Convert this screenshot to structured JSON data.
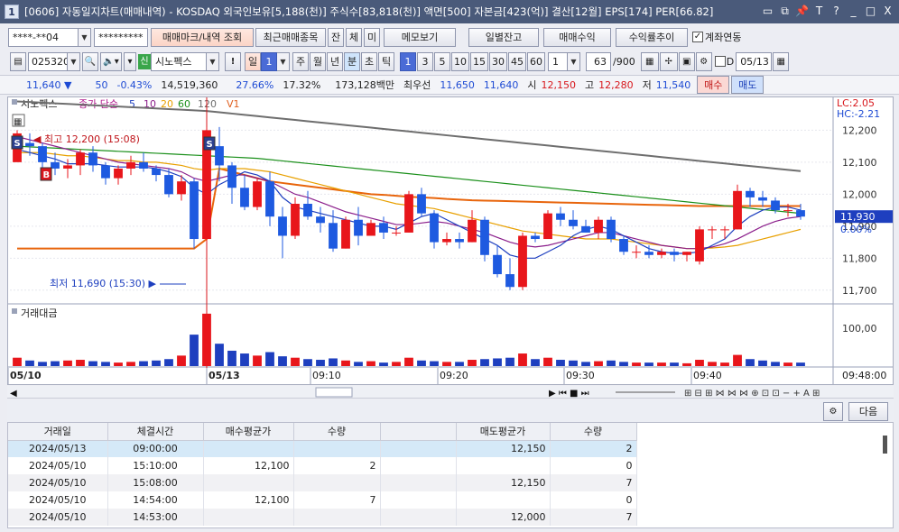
{
  "window": {
    "icon": "1",
    "title": "[0606] 자동일지차트(매매내역) - KOSDAQ 외국인보유[5,188(천)] 주식수[83,818(천)] 액면[500] 자본금[423(억)] 결산[12월] EPS[174] PER[66.82]",
    "controls": [
      "▭",
      "⧉",
      "📌",
      "T",
      "?",
      "_",
      "□",
      "X"
    ]
  },
  "toolbar1": {
    "account": "****-**04",
    "password": "*********",
    "trade_mark_btn": "매매마크/내역 조회",
    "recent_btn": "최근매매종목",
    "jan_btn": "잔",
    "che_btn": "체",
    "mi_btn": "미",
    "memo_btn": "메모보기",
    "daily_balance_btn": "일별잔고",
    "trade_profit_btn": "매매수익",
    "profit_rate_btn": "수익률추이",
    "account_link_label": "계좌연동",
    "account_link_checked": true
  },
  "toolbar2": {
    "code": "025320",
    "new_badge": "신",
    "stock_name": "시노펙스",
    "excl": "!",
    "periods": [
      "일",
      "1",
      "주",
      "월",
      "년",
      "분",
      "초",
      "틱"
    ],
    "period_selected": "분",
    "intervals": [
      "1",
      "3",
      "5",
      "10",
      "15",
      "30",
      "45",
      "60"
    ],
    "interval_selected": "1",
    "interval_value": "1",
    "count": "63",
    "count_total": "/900",
    "date_check_label": "D",
    "date": "05/13"
  },
  "quote": {
    "price": "11,640",
    "change": "50",
    "change_pct": "-0.43%",
    "volume": "14,519,360",
    "pct1": "27.66%",
    "pct2": "17.32%",
    "amount": "173,128백만",
    "pref_label": "최우선",
    "ask": "11,650",
    "bid": "11,640",
    "open_label": "시",
    "open": "12,150",
    "high_label": "고",
    "high": "12,280",
    "low_label": "저",
    "low": "11,540",
    "buy_btn": "매수",
    "sell_btn": "매도"
  },
  "chart_data": {
    "type": "candlestick",
    "legend": {
      "stock": "시노펙스",
      "ma_label": "종가 단순",
      "ma_periods": [
        "5",
        "10",
        "20",
        "60",
        "120"
      ],
      "ma_colors": [
        "#1e3fbf",
        "#8b1e8b",
        "#e8a000",
        "#1a8f1a",
        "#6e6e6e"
      ],
      "volume_label": "V1"
    },
    "right_labels": {
      "lc": "LC:2.05",
      "hc": "HC:-2.21"
    },
    "y_ticks": [
      "12,200",
      "12,100",
      "12,000",
      "11,900",
      "11,800",
      "11,700"
    ],
    "y_range": [
      11660,
      12280
    ],
    "current_price_label": "11,930",
    "zero_label": "0.00%",
    "annotations": {
      "high": "최고 12,200 (15:08)",
      "low": "최저 11,690 (15:30)"
    },
    "trade_markers": [
      {
        "type": "S",
        "time": "15:08",
        "price": 12200
      },
      {
        "type": "B",
        "time": "15:10",
        "price": 12100
      },
      {
        "type": "S",
        "time": "09:00",
        "price": 12150
      }
    ],
    "x_labels": [
      "05/10",
      "05/13",
      "09:10",
      "09:20",
      "09:30",
      "09:40",
      "09:48:00"
    ],
    "candles": [
      [
        12100,
        12200,
        12150,
        12190
      ],
      [
        12160,
        12190,
        12120,
        12150
      ],
      [
        12150,
        12160,
        12080,
        12100
      ],
      [
        12100,
        12130,
        12060,
        12080
      ],
      [
        12080,
        12110,
        12050,
        12090
      ],
      [
        12090,
        12140,
        12060,
        12130
      ],
      [
        12130,
        12150,
        12070,
        12090
      ],
      [
        12090,
        12100,
        12030,
        12050
      ],
      [
        12050,
        12090,
        12030,
        12080
      ],
      [
        12080,
        12120,
        12060,
        12100
      ],
      [
        12100,
        12130,
        12070,
        12080
      ],
      [
        12080,
        12090,
        12040,
        12060
      ],
      [
        12060,
        12080,
        11990,
        12000
      ],
      [
        12000,
        12060,
        11980,
        12040
      ],
      [
        12040,
        12050,
        11830,
        11860
      ],
      [
        11860,
        12210,
        11850,
        12200
      ],
      [
        12150,
        12210,
        12040,
        12090
      ],
      [
        12090,
        12100,
        11970,
        12020
      ],
      [
        12020,
        12060,
        11950,
        11960
      ],
      [
        11960,
        12050,
        11950,
        12040
      ],
      [
        12040,
        12070,
        11900,
        11930
      ],
      [
        11930,
        11960,
        11800,
        11870
      ],
      [
        11870,
        11990,
        11860,
        11970
      ],
      [
        11970,
        12010,
        11920,
        11930
      ],
      [
        11930,
        11960,
        11880,
        11910
      ],
      [
        11910,
        11950,
        11820,
        11830
      ],
      [
        11830,
        11930,
        11830,
        11920
      ],
      [
        11920,
        11960,
        11840,
        11870
      ],
      [
        11870,
        11920,
        11870,
        11910
      ],
      [
        11910,
        11930,
        11860,
        11880
      ],
      [
        11880,
        11900,
        11870,
        11880
      ],
      [
        11880,
        12010,
        11880,
        12000
      ],
      [
        12000,
        12020,
        11930,
        11940
      ],
      [
        11940,
        11950,
        11830,
        11850
      ],
      [
        11850,
        11880,
        11840,
        11860
      ],
      [
        11860,
        11880,
        11830,
        11850
      ],
      [
        11850,
        11950,
        11850,
        11920
      ],
      [
        11920,
        11930,
        11790,
        11810
      ],
      [
        11810,
        11840,
        11740,
        11750
      ],
      [
        11750,
        11800,
        11700,
        11710
      ],
      [
        11710,
        11880,
        11700,
        11870
      ],
      [
        11870,
        11880,
        11850,
        11860
      ],
      [
        11860,
        11950,
        11860,
        11940
      ],
      [
        11940,
        11960,
        11900,
        11920
      ],
      [
        11920,
        11950,
        11890,
        11900
      ],
      [
        11900,
        11920,
        11880,
        11880
      ],
      [
        11880,
        11930,
        11860,
        11920
      ],
      [
        11920,
        11930,
        11850,
        11860
      ],
      [
        11860,
        11870,
        11810,
        11820
      ],
      [
        11820,
        11840,
        11800,
        11820
      ],
      [
        11820,
        11840,
        11800,
        11810
      ],
      [
        11810,
        11830,
        11800,
        11820
      ],
      [
        11820,
        11830,
        11790,
        11810
      ],
      [
        11810,
        11820,
        11790,
        11820
      ],
      [
        11790,
        11900,
        11780,
        11890
      ],
      [
        11890,
        11900,
        11860,
        11890
      ],
      [
        11890,
        11900,
        11860,
        11890
      ],
      [
        11890,
        12030,
        11890,
        12010
      ],
      [
        12010,
        12020,
        11960,
        11990
      ],
      [
        11990,
        12010,
        11960,
        11980
      ],
      [
        11980,
        11990,
        11940,
        11950
      ],
      [
        11950,
        11970,
        11930,
        11950
      ],
      [
        11950,
        11970,
        11920,
        11930
      ]
    ],
    "ma": {
      "ma5": [
        12140,
        12130,
        12120,
        12110,
        12095,
        12095,
        12095,
        12090,
        12085,
        12085,
        12085,
        12080,
        12070,
        12055,
        12020,
        12000,
        12030,
        12050,
        12070,
        12060,
        12040,
        11990,
        11960,
        11950,
        11940,
        11930,
        11920,
        11910,
        11900,
        11900,
        11890,
        11910,
        11930,
        11940,
        11920,
        11900,
        11880,
        11860,
        11840,
        11810,
        11800,
        11800,
        11820,
        11840,
        11870,
        11890,
        11900,
        11890,
        11870,
        11850,
        11830,
        11820,
        11815,
        11815,
        11820,
        11840,
        11860,
        11900,
        11930,
        11950,
        11960,
        11960,
        11950
      ],
      "ma10": [
        12180,
        12170,
        12160,
        12150,
        12140,
        12130,
        12120,
        12110,
        12100,
        12095,
        12090,
        12085,
        12080,
        12070,
        12050,
        12040,
        12050,
        12060,
        12060,
        12050,
        12040,
        12020,
        12000,
        11990,
        11975,
        11960,
        11945,
        11935,
        11925,
        11915,
        11905,
        11905,
        11910,
        11915,
        11910,
        11900,
        11890,
        11880,
        11865,
        11850,
        11840,
        11835,
        11840,
        11850,
        11860,
        11870,
        11880,
        11880,
        11870,
        11860,
        11850,
        11840,
        11835,
        11830,
        11830,
        11835,
        11845,
        11860,
        11880,
        11900,
        11915,
        11925,
        11930
      ],
      "ma20": [
        12130,
        12130,
        12130,
        12125,
        12120,
        12120,
        12115,
        12110,
        12105,
        12105,
        12100,
        12100,
        12095,
        12090,
        12080,
        12075,
        12080,
        12080,
        12080,
        12075,
        12070,
        12060,
        12050,
        12040,
        12030,
        12020,
        12010,
        12000,
        11990,
        11980,
        11970,
        11965,
        11960,
        11955,
        11945,
        11935,
        11925,
        11915,
        11905,
        11895,
        11885,
        11880,
        11875,
        11870,
        11865,
        11860,
        11860,
        11860,
        11855,
        11850,
        11845,
        11840,
        11835,
        11830,
        11830,
        11832,
        11835,
        11840,
        11850,
        11860,
        11870,
        11880,
        11890
      ],
      "ma60": [
        12150,
        12148,
        12146,
        12144,
        12142,
        12140,
        12138,
        12136,
        12134,
        12132,
        12130,
        12128,
        12126,
        12124,
        12122,
        12120,
        12118,
        12116,
        12114,
        12112,
        12108,
        12104,
        12100,
        12096,
        12092,
        12088,
        12084,
        12080,
        12076,
        12072,
        12068,
        12064,
        12060,
        12056,
        12052,
        12048,
        12044,
        12040,
        12036,
        12032,
        12028,
        12024,
        12020,
        12016,
        12012,
        12008,
        12004,
        12000,
        11996,
        11992,
        11988,
        11984,
        11980,
        11976,
        11972,
        11968,
        11964,
        11960,
        11956,
        11952,
        11948,
        11944,
        11940
      ],
      "ma120": [
        12290,
        12288,
        12286,
        12284,
        12282,
        12280,
        12278,
        12276,
        12274,
        12272,
        12270,
        12268,
        12266,
        12264,
        12262,
        12260,
        12256,
        12252,
        12248,
        12244,
        12240,
        12236,
        12232,
        12228,
        12224,
        12220,
        12216,
        12212,
        12208,
        12204,
        12200,
        12196,
        12192,
        12188,
        12184,
        12180,
        12176,
        12172,
        12168,
        12164,
        12160,
        12156,
        12152,
        12148,
        12144,
        12140,
        12136,
        12132,
        12128,
        12124,
        12120,
        12116,
        12112,
        12108,
        12104,
        12100,
        12096,
        12092,
        12088,
        12084,
        12080,
        12076,
        12072
      ]
    },
    "orange_line": [
      11830,
      11830,
      11830,
      11830,
      11830,
      11830,
      11830,
      11830,
      11830,
      11830,
      11830,
      11830,
      11830,
      11830,
      11830,
      11860,
      12080,
      12070,
      12060,
      12050,
      12040,
      12035,
      12030,
      12025,
      12020,
      12015,
      12010,
      12005,
      12000,
      11998,
      11995,
      11992,
      11990,
      11988,
      11985,
      11983,
      11981,
      11980,
      11979,
      11978,
      11977,
      11976,
      11975,
      11974,
      11973,
      11972,
      11971,
      11970,
      11969,
      11968,
      11967,
      11966,
      11965,
      11964,
      11963,
      11963,
      11963,
      11963,
      11963,
      11963,
      11963,
      11963,
      11963
    ],
    "volume_label": "거래대금",
    "volume_tick": "100,00",
    "volumes": [
      12,
      8,
      6,
      7,
      8,
      9,
      7,
      6,
      5,
      6,
      7,
      8,
      10,
      15,
      45,
      75,
      32,
      22,
      18,
      15,
      20,
      14,
      12,
      10,
      9,
      11,
      8,
      6,
      7,
      5,
      6,
      12,
      8,
      7,
      6,
      6,
      9,
      10,
      11,
      12,
      18,
      10,
      12,
      9,
      8,
      6,
      7,
      8,
      6,
      5,
      5,
      5,
      5,
      4,
      9,
      6,
      5,
      16,
      10,
      8,
      6,
      5,
      5
    ]
  },
  "grid": {
    "next_btn": "다음",
    "columns": [
      "거래일",
      "체결시간",
      "매수평균가",
      "수량",
      "",
      "매도평균가",
      "수량"
    ],
    "rows": [
      [
        "2024/05/13",
        "09:00:00",
        "",
        "",
        "",
        "12,150",
        "2"
      ],
      [
        "2024/05/10",
        "15:10:00",
        "12,100",
        "2",
        "",
        "",
        "0"
      ],
      [
        "2024/05/10",
        "15:08:00",
        "",
        "",
        "",
        "12,150",
        "7"
      ],
      [
        "2024/05/10",
        "14:54:00",
        "12,100",
        "7",
        "",
        "",
        "0"
      ],
      [
        "2024/05/10",
        "14:53:00",
        "",
        "",
        "",
        "12,000",
        "7"
      ]
    ]
  }
}
